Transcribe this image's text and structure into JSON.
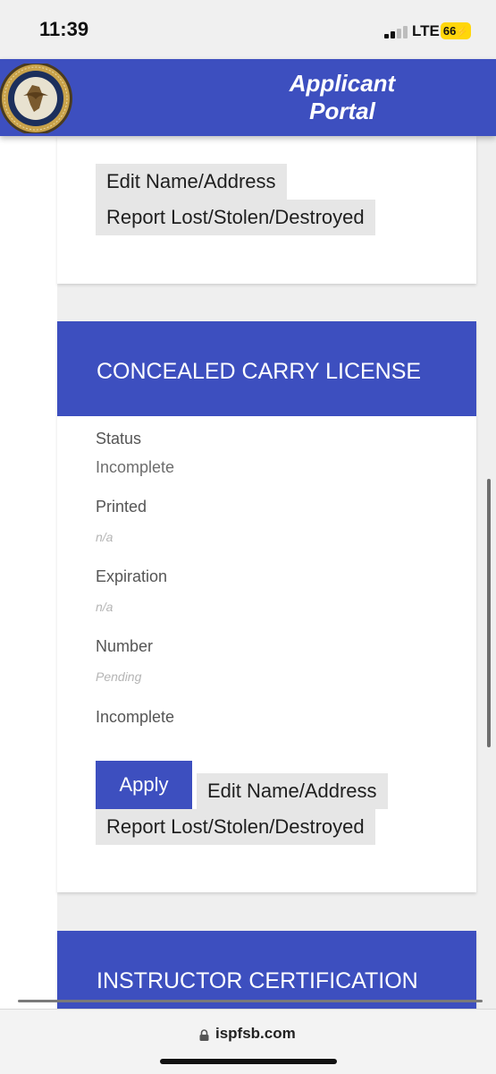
{
  "status_bar": {
    "time": "11:39",
    "network": "LTE",
    "battery": "66"
  },
  "header": {
    "title_line1": "Applicant",
    "title_line2": "Portal",
    "logo_icon": "illinois-state-police-seal-icon"
  },
  "top_card": {
    "edit_button": "Edit Name/Address",
    "report_button": "Report Lost/Stolen/Destroyed"
  },
  "ccl_card": {
    "title": "CONCEALED CARRY LICENSE",
    "fields": [
      {
        "label": "Status",
        "value": "Incomplete"
      },
      {
        "label": "Printed",
        "value": "n/a"
      },
      {
        "label": "Expiration",
        "value": "n/a"
      },
      {
        "label": "Number",
        "value": "Pending"
      }
    ],
    "footer_status": "Incomplete",
    "apply_button": "Apply",
    "edit_button": "Edit Name/Address",
    "report_button": "Report Lost/Stolen/Destroyed"
  },
  "instructor_card": {
    "title": "INSTRUCTOR CERTIFICATION"
  },
  "browser": {
    "url": "ispfsb.com",
    "lock_icon": "lock-icon"
  },
  "colors": {
    "brand_blue": "#3d4fbf",
    "battery_yellow": "#ffd60a"
  }
}
